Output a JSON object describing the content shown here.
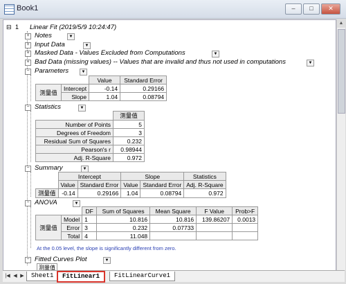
{
  "window": {
    "title": "Book1",
    "controls": {
      "minimize": "–",
      "maximize": "□",
      "close": "✕"
    }
  },
  "report": {
    "row_number": "1",
    "header": "Linear Fit (2019/5/9 10:24:47)",
    "nodes": {
      "notes": "Notes",
      "input_data": "Input Data",
      "masked_data": "Masked Data - Values Excluded from Computations",
      "bad_data": "Bad Data (missing values) -- Values that are invalid and thus not used in computations",
      "parameters": "Parameters",
      "statistics": "Statistics",
      "summary": "Summary",
      "anova": "ANOVA",
      "fitted_curves": "Fitted Curves Plot"
    },
    "parameters": {
      "headers": [
        "Value",
        "Standard Error"
      ],
      "side_label": "测量值",
      "rows": [
        {
          "name": "Intercept",
          "value": "-0.14",
          "se": "0.29166"
        },
        {
          "name": "Slope",
          "value": "1.04",
          "se": "0.08794"
        }
      ]
    },
    "statistics": {
      "header": "测量值",
      "rows": [
        {
          "name": "Number of Points",
          "value": "5"
        },
        {
          "name": "Degrees of Freedom",
          "value": "3"
        },
        {
          "name": "Residual Sum of Squares",
          "value": "0.232"
        },
        {
          "name": "Pearson's r",
          "value": "0.98944"
        },
        {
          "name": "Adj. R-Square",
          "value": "0.972"
        }
      ]
    },
    "summary": {
      "groups": [
        "Intercept",
        "Slope",
        "Statistics"
      ],
      "subheaders": [
        "Value",
        "Standard Error",
        "Value",
        "Standard Error",
        "Adj. R-Square"
      ],
      "side_label": "测量值",
      "values": [
        "-0.14",
        "0.29166",
        "1.04",
        "0.08794",
        "0.972"
      ]
    },
    "anova": {
      "headers": [
        "DF",
        "Sum of Squares",
        "Mean Square",
        "F Value",
        "Prob>F"
      ],
      "side_label": "测量值",
      "rows": [
        {
          "name": "Model",
          "df": "1",
          "ss": "10.816",
          "ms": "10.816",
          "f": "139.86207",
          "p": "0.0013"
        },
        {
          "name": "Error",
          "df": "3",
          "ss": "0.232",
          "ms": "0.07733",
          "f": "",
          "p": ""
        },
        {
          "name": "Total",
          "df": "4",
          "ss": "11.048",
          "ms": "",
          "f": "",
          "p": ""
        }
      ],
      "note": "At the 0.05 level, the slope is significantly different from zero."
    },
    "fitted_curves_label": "测量值"
  },
  "tabs": [
    "Sheet1",
    "FitLinear1",
    "FitLinearCurve1"
  ],
  "active_tab": "FitLinear1",
  "colors": {
    "active_tab_border": "#d9342b",
    "note_text": "#2a3fb3"
  }
}
